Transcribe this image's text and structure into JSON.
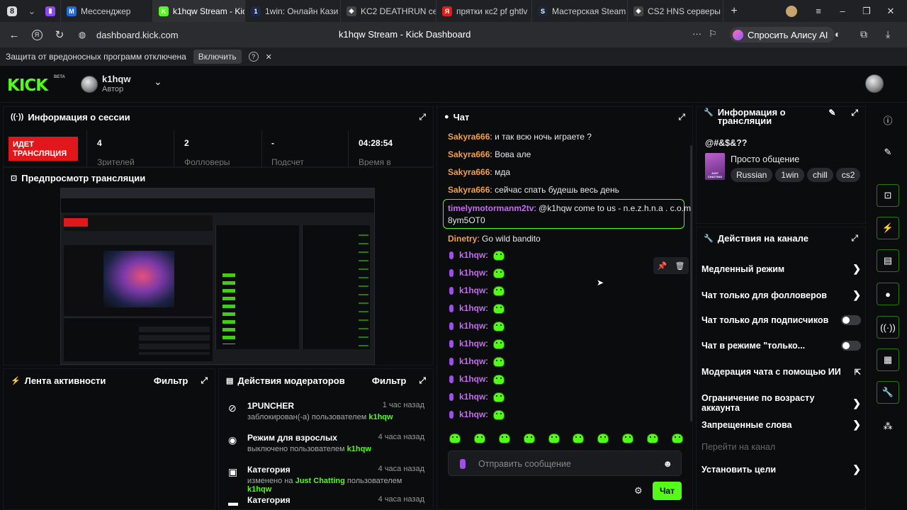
{
  "browser": {
    "tab_counter": "8",
    "tabs": [
      {
        "title": "Мессенджер",
        "color": "#1d6ce0",
        "glyph": "M"
      },
      {
        "title": "k1hqw Stream - Kick",
        "color": "#53fc18",
        "glyph": "K"
      },
      {
        "title": "1win: Онлайн Кази",
        "color": "#1b2a4a",
        "glyph": "1"
      },
      {
        "title": "KC2 DEATHRUN се",
        "color": "#444",
        "glyph": "◈"
      },
      {
        "title": "прятки кс2 pf ghtlv",
        "color": "#e21b1b",
        "glyph": "Я"
      },
      {
        "title": "Мастерская Steam",
        "color": "#1b2838",
        "glyph": "S"
      },
      {
        "title": "CS2 HNS серверы",
        "color": "#444",
        "glyph": "◈"
      }
    ],
    "url": "dashboard.kick.com",
    "page_title": "k1hqw Stream - Kick Dashboard",
    "alisa": "Спросить Алису AI",
    "warning": "Защита от вредоносных программ отключена",
    "warning_button": "Включить"
  },
  "header": {
    "logo": "KICK",
    "beta": "BETA",
    "username": "k1hqw",
    "role": "Автор"
  },
  "session": {
    "title": "Информация о сессии",
    "live_badge": "ИДЕТ ТРАНСЛЯЦИЯ",
    "viewers_value": "4",
    "viewers_label": "Зрителей",
    "followers_value": "2",
    "followers_label": "Фолловеры",
    "subs_value": "-",
    "subs_label": "Подсчет",
    "time_value": "04:28:54",
    "time_label": "Время в"
  },
  "preview": {
    "title": "Предпросмотр трансляции"
  },
  "activity": {
    "title": "Лента активности",
    "filter": "Фильтр"
  },
  "modactions": {
    "title": "Действия модераторов",
    "filter": "Фильтр",
    "items": [
      {
        "title": "1PUNCHER",
        "desc": "заблокирован(-а) пользователем",
        "highlight": "",
        "by": "k1hqw",
        "ago": "1 час назад"
      },
      {
        "title": "Режим для взрослых",
        "desc": "выключено пользователем",
        "highlight": "",
        "by": "k1hqw",
        "ago": "4 часа назад"
      },
      {
        "title": "Категория",
        "desc": "изменено на",
        "highlight": "Just Chatting",
        "desc2": "пользователем",
        "by": "k1hqw",
        "ago": "4 часа назад"
      },
      {
        "title": "Категория",
        "desc": "",
        "highlight": "",
        "by": "",
        "ago": "4 часа назад"
      }
    ]
  },
  "chat": {
    "title": "Чат",
    "messages": [
      {
        "user": "Sakyra666",
        "text": "и так всю ночь играете ?"
      },
      {
        "user": "Sakyra666",
        "text": "Вова але"
      },
      {
        "user": "Sakyra666",
        "text": "мда"
      },
      {
        "user": "Sakyra666",
        "text": "сейчас спать будешь весь день"
      }
    ],
    "highlighted": {
      "user": "timelymotormanm2tv",
      "text": "@k1hqw come to us - n.e.z.h.n.a . c.o.m",
      "text2": "8ym5OT0"
    },
    "dinetry": {
      "user": "Dinetry",
      "text": "Go wild bandito"
    },
    "emote_user": "k1hqw",
    "emote_rows": 10,
    "placeholder": "Отправить сообщение",
    "send": "Чат",
    "colors": {
      "sakyra": "#f0a04b",
      "timely": "#c46cf0",
      "dinetry": "#f0a04b",
      "k1hqw": "#c46cf0",
      "accent": "#53fc18"
    }
  },
  "stream_info": {
    "title": "Информация о трансляции",
    "stream_title": "@#&$&??",
    "category": "Просто общение",
    "category_thumb": "JUST CHATTING",
    "tags": [
      "Russian",
      "1win",
      "chill",
      "cs2"
    ]
  },
  "channel_actions": {
    "title": "Действия на канале",
    "items": [
      {
        "label": "Медленный режим",
        "kind": "chevron"
      },
      {
        "label": "Чат только для фолловеров",
        "kind": "chevron"
      },
      {
        "label": "Чат только для подписчиков",
        "kind": "toggle"
      },
      {
        "label": "Чат в режиме \"только...",
        "kind": "toggle"
      },
      {
        "label": "Модерация чата с помощью ИИ",
        "kind": "external"
      },
      {
        "label": "Ограничение по возрасту аккаунта",
        "kind": "chevron"
      },
      {
        "label": "Запрещенные слова",
        "kind": "chevron"
      },
      {
        "label": "Перейти на канал",
        "kind": "disabled"
      },
      {
        "label": "Установить цели",
        "kind": "chevron"
      }
    ]
  }
}
